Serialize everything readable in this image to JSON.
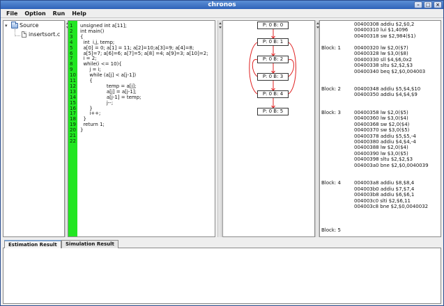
{
  "window": {
    "title": "chronos"
  },
  "menubar": {
    "items": [
      "File",
      "Option",
      "Run",
      "Help"
    ]
  },
  "tree": {
    "root": "Source",
    "child": "insertsort.c"
  },
  "code": {
    "lines": [
      "unsigned int a[11];",
      "int main()",
      "{",
      "  int  i,j, temp;",
      "  a[0] = 0; a[1] = 11; a[2]=10;a[3]=9; a[4]=8;",
      "  a[5]=7; a[6]=6; a[7]=5; a[8] =4; a[9]=3; a[10]=2;",
      "  i = 2;",
      "  while(i <= 10){",
      "      j = i;",
      "      while (a[j] < a[j-1])",
      "      {",
      "                 temp = a[j];",
      "                 a[j] = a[j-1];",
      "                 a[j-1] = temp;",
      "                 j--;",
      "      }",
      "      i++;",
      "  }",
      "  return 1;",
      "}",
      "",
      ""
    ]
  },
  "graph": {
    "nodes": [
      "P: 0 B: 0",
      "P: 0 B: 1",
      "P: 0 B: 2",
      "P: 0 B: 3",
      "P: 0 B: 4",
      "P: 0 B: 5"
    ],
    "edge_color": "#e02020"
  },
  "asm": {
    "blocks": [
      {
        "label": "",
        "lines": [
          "00400308 addiu $2,$0,2",
          "00400310 lui $1,4096",
          "00400318 sw $2,984($1)"
        ]
      },
      {
        "label": "Block:  1",
        "lines": [
          "00400320 lw $2,0($7)",
          "00400328 lw $3,0($8)",
          "00400330 sll $4,$6,0x2",
          "00400338 sltu $2,$2,$3",
          "00400340 beq $2,$0,004003"
        ]
      },
      {
        "label": "Block:  2",
        "lines": [
          "00400348 addiu $5,$4,$10",
          "00400350 addiu $4,$4,$9"
        ]
      },
      {
        "label": "Block:  3",
        "lines": [
          "00400358 lw $2,0($5)",
          "00400360 lw $3,0($4)",
          "00400368 sw $2,0($4)",
          "00400370 sw $3,0($5)",
          "00400378 addiu $5,$5,-4",
          "00400380 addiu $4,$4,-4",
          "00400388 lw $2,0($4)",
          "00400390 lw $3,0($5)",
          "00400398 sltu $2,$2,$3",
          "004003a0 bne $2,$0,0040039"
        ]
      },
      {
        "label": "Block:  4",
        "lines": [
          "004003a8 addiu $8,$8,4",
          "004003b0 addiu $7,$7,4",
          "004003b8 addiu $6,$6,1",
          "004003c0 slti $2,$6,11",
          "004003c8 bne $2,$0,0040032"
        ]
      },
      {
        "label": "Block:  5",
        "lines": []
      }
    ]
  },
  "tabs": [
    {
      "label": "Estimation Result",
      "active": true
    },
    {
      "label": "Simulation Result",
      "active": false
    }
  ]
}
